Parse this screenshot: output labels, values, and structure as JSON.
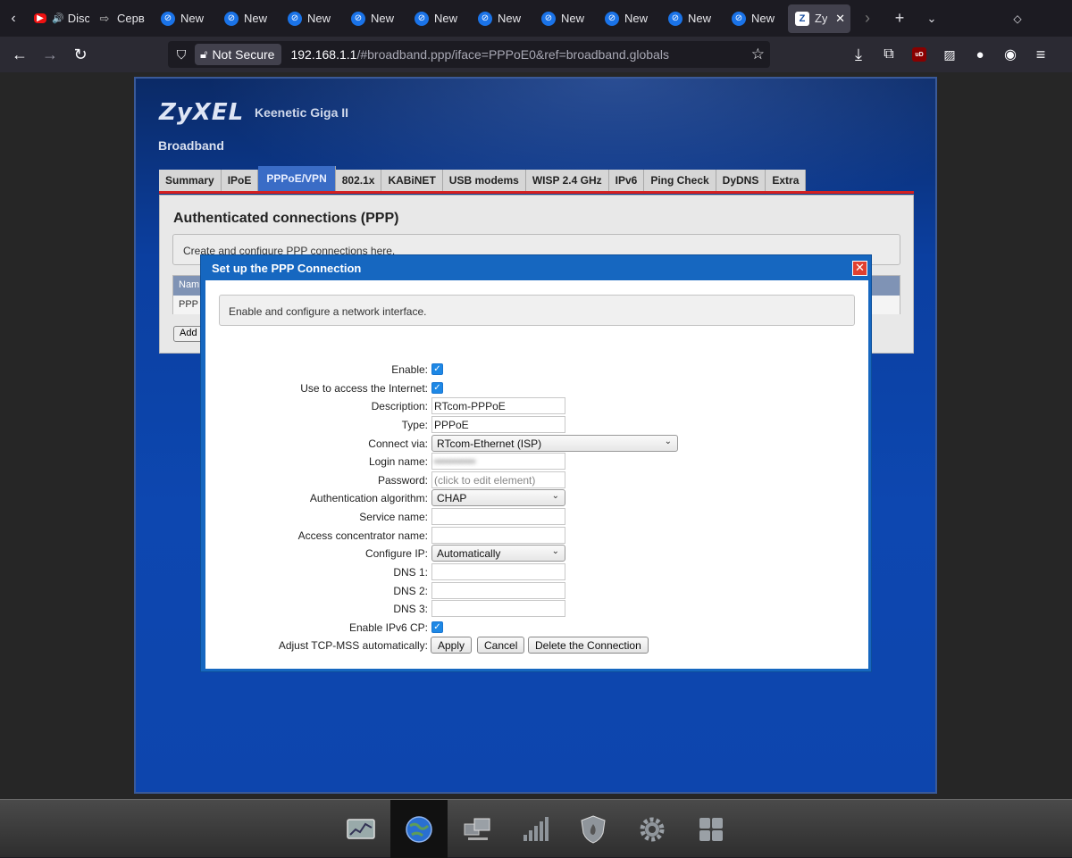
{
  "browser": {
    "tabs": [
      {
        "label": "Disco",
        "icon": "youtube-icon",
        "audio": true
      },
      {
        "label": "Серв",
        "icon": "redirect-icon"
      },
      {
        "label": "New",
        "icon": "new-tab-icon"
      },
      {
        "label": "New",
        "icon": "new-tab-icon"
      },
      {
        "label": "New",
        "icon": "new-tab-icon"
      },
      {
        "label": "New",
        "icon": "new-tab-icon"
      },
      {
        "label": "New",
        "icon": "new-tab-icon"
      },
      {
        "label": "New",
        "icon": "new-tab-icon"
      },
      {
        "label": "New",
        "icon": "new-tab-icon"
      },
      {
        "label": "New",
        "icon": "new-tab-icon"
      },
      {
        "label": "New",
        "icon": "new-tab-icon"
      },
      {
        "label": "New",
        "icon": "new-tab-icon"
      },
      {
        "label": "Zy",
        "icon": "zyxel-favicon",
        "active": true
      }
    ],
    "security_label": "Not Secure",
    "url_host": "192.168.1.1",
    "url_rest": "/#broadband.ppp/iface=PPPoE0&ref=broadband.globals"
  },
  "router": {
    "brand": "ZyXEL",
    "model": "Keenetic Giga II",
    "section": "Broadband",
    "tabs": [
      "Summary",
      "IPoE",
      "PPPoE/VPN",
      "802.1x",
      "KABiNET",
      "USB modems",
      "WISP 2.4 GHz",
      "IPv6",
      "Ping Check",
      "DyDNS",
      "Extra"
    ],
    "active_tab": "PPPoE/VPN",
    "panel": {
      "title": "Authenticated connections (PPP)",
      "info": "Create and configure PPP connections here.",
      "table_header": "Nam",
      "table_row": "PPP",
      "add_button": "Add"
    }
  },
  "modal": {
    "title": "Set up the PPP Connection",
    "info": "Enable and configure a network interface.",
    "fields": {
      "enable": {
        "label": "Enable:",
        "checked": true
      },
      "internet": {
        "label": "Use to access the Internet:",
        "checked": true
      },
      "description": {
        "label": "Description:",
        "value": "RTcom-PPPoE"
      },
      "type": {
        "label": "Type:",
        "value": "PPPoE"
      },
      "connect_via": {
        "label": "Connect via:",
        "value": "RTcom-Ethernet (ISP)"
      },
      "login": {
        "label": "Login name:",
        "value": "•••••••••••"
      },
      "password": {
        "label": "Password:",
        "placeholder": "(click to edit element)"
      },
      "auth": {
        "label": "Authentication algorithm:",
        "value": "CHAP"
      },
      "service": {
        "label": "Service name:",
        "value": ""
      },
      "concentrator": {
        "label": "Access concentrator name:",
        "value": ""
      },
      "configure_ip": {
        "label": "Configure IP:",
        "value": "Automatically"
      },
      "dns1": {
        "label": "DNS 1:",
        "value": ""
      },
      "dns2": {
        "label": "DNS 2:",
        "value": ""
      },
      "dns3": {
        "label": "DNS 3:",
        "value": ""
      },
      "ipv6cp": {
        "label": "Enable IPv6 CP:",
        "checked": true
      },
      "tcpmss": {
        "label": "Adjust TCP-MSS automatically:",
        "checked": false
      }
    },
    "buttons": {
      "apply": "Apply",
      "cancel": "Cancel",
      "delete": "Delete the Connection"
    },
    "close_glyph": "✕"
  },
  "dock": {
    "items": [
      "monitor-icon",
      "internet-globe-icon",
      "home-network-icon",
      "wifi-signal-icon",
      "security-shield-icon",
      "system-gear-icon",
      "applications-grid-icon"
    ],
    "active": "internet-globe-icon"
  },
  "colors": {
    "accent": "#1667c0",
    "tab_underline": "#d42020",
    "checkbox": "#1e88e5"
  }
}
